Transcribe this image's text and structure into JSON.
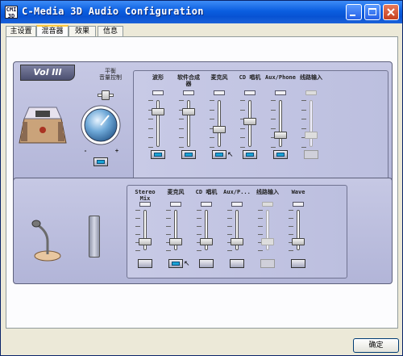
{
  "window": {
    "title": "C-Media 3D Audio Configuration",
    "icon_text": "CMI 3D"
  },
  "tabs": [
    {
      "label": "主设置",
      "active": false
    },
    {
      "label": "混音器",
      "active": true
    },
    {
      "label": "效果",
      "active": false
    },
    {
      "label": "信息",
      "active": false
    }
  ],
  "playback": {
    "badge": "Vol III",
    "balance_label": "平衡\n音量控制",
    "master": {
      "minus": "-",
      "plus": "+"
    },
    "channels": [
      {
        "label": "波形",
        "level": 0.8,
        "mute_on": true,
        "enabled": true
      },
      {
        "label": "软件合成\n器",
        "level": 0.8,
        "mute_on": true,
        "enabled": true
      },
      {
        "label": "麦克风",
        "level": 0.35,
        "mute_on": true,
        "enabled": true
      },
      {
        "label": "CD 唱机",
        "level": 0.55,
        "mute_on": true,
        "enabled": true
      },
      {
        "label": "Aux/Phone",
        "level": 0.2,
        "mute_on": true,
        "enabled": true
      },
      {
        "label": "线路输入",
        "level": 0.2,
        "mute_on": false,
        "enabled": false
      }
    ]
  },
  "recording": {
    "channels": [
      {
        "label": "Stereo\nMix",
        "level": 0.15,
        "selected": false,
        "enabled": true
      },
      {
        "label": "麦克风",
        "level": 0.15,
        "selected": true,
        "enabled": true
      },
      {
        "label": "CD 唱机",
        "level": 0.15,
        "selected": false,
        "enabled": true
      },
      {
        "label": "Aux/P...",
        "level": 0.15,
        "selected": false,
        "enabled": true
      },
      {
        "label": "线路输入",
        "level": 0.15,
        "selected": false,
        "enabled": false
      },
      {
        "label": "Wave",
        "level": 0.15,
        "selected": false,
        "enabled": true
      }
    ]
  },
  "ok_button": "确定",
  "colors": {
    "titlebar": "#0b5ee0",
    "mute_on": "#1aa3d6",
    "panel": "#b8bbdd"
  }
}
